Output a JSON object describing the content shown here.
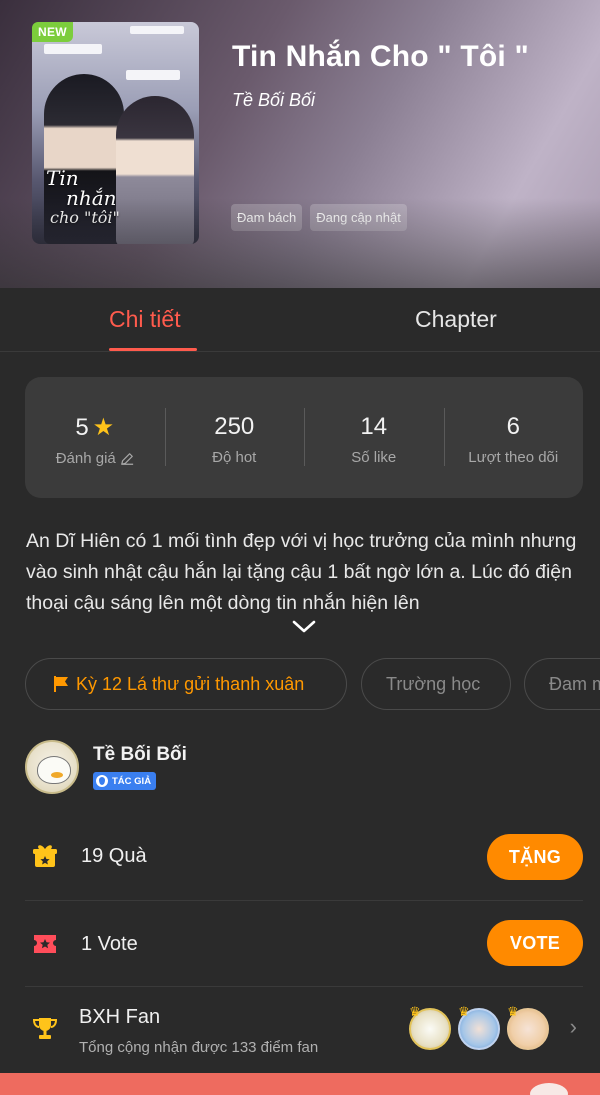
{
  "header": {
    "new_badge": "NEW",
    "title": "Tin Nhắn Cho \" Tôi \"",
    "author": "Tề Bối Bối",
    "tags": [
      "Đam bách",
      "Đang cập nhật"
    ],
    "cover_title_lines": [
      "Tin",
      "nhắn",
      "cho \"tôi\""
    ]
  },
  "tabs": {
    "details": "Chi tiết",
    "chapter": "Chapter"
  },
  "stats": [
    {
      "value": "5",
      "label": "Đánh giá"
    },
    {
      "value": "250",
      "label": "Độ hot"
    },
    {
      "value": "14",
      "label": "Số like"
    },
    {
      "value": "6",
      "label": "Lượt theo dõi"
    }
  ],
  "description": "An Dĩ Hiên có 1 mối tình đẹp với vị học trưởng của mình nhưng vào sinh nhật cậu hắn lại tặng cậu 1 bất ngờ lớn a. Lúc đó điện thoại cậu sáng lên một dòng tin nhắn hiện lên",
  "chips": {
    "event": "Kỳ 12 Lá thư gửi thanh xuân",
    "chip2": "Trường học",
    "chip3": "Đam mỹ"
  },
  "author_block": {
    "name": "Tề Bối Bối",
    "badge": "TÁC GIẢ"
  },
  "gifts": {
    "text": "19  Quà",
    "button": "TẶNG"
  },
  "votes": {
    "text": "1  Vote",
    "button": "VOTE"
  },
  "fan_rank": {
    "title": "BXH Fan",
    "subtitle": "Tổng cộng nhận được 133 điểm fan"
  },
  "colors": {
    "accent_red": "#ff5b4d",
    "accent_orange": "#ff8a00",
    "background": "#2a2a2a",
    "new_badge": "#7ccd3c"
  }
}
